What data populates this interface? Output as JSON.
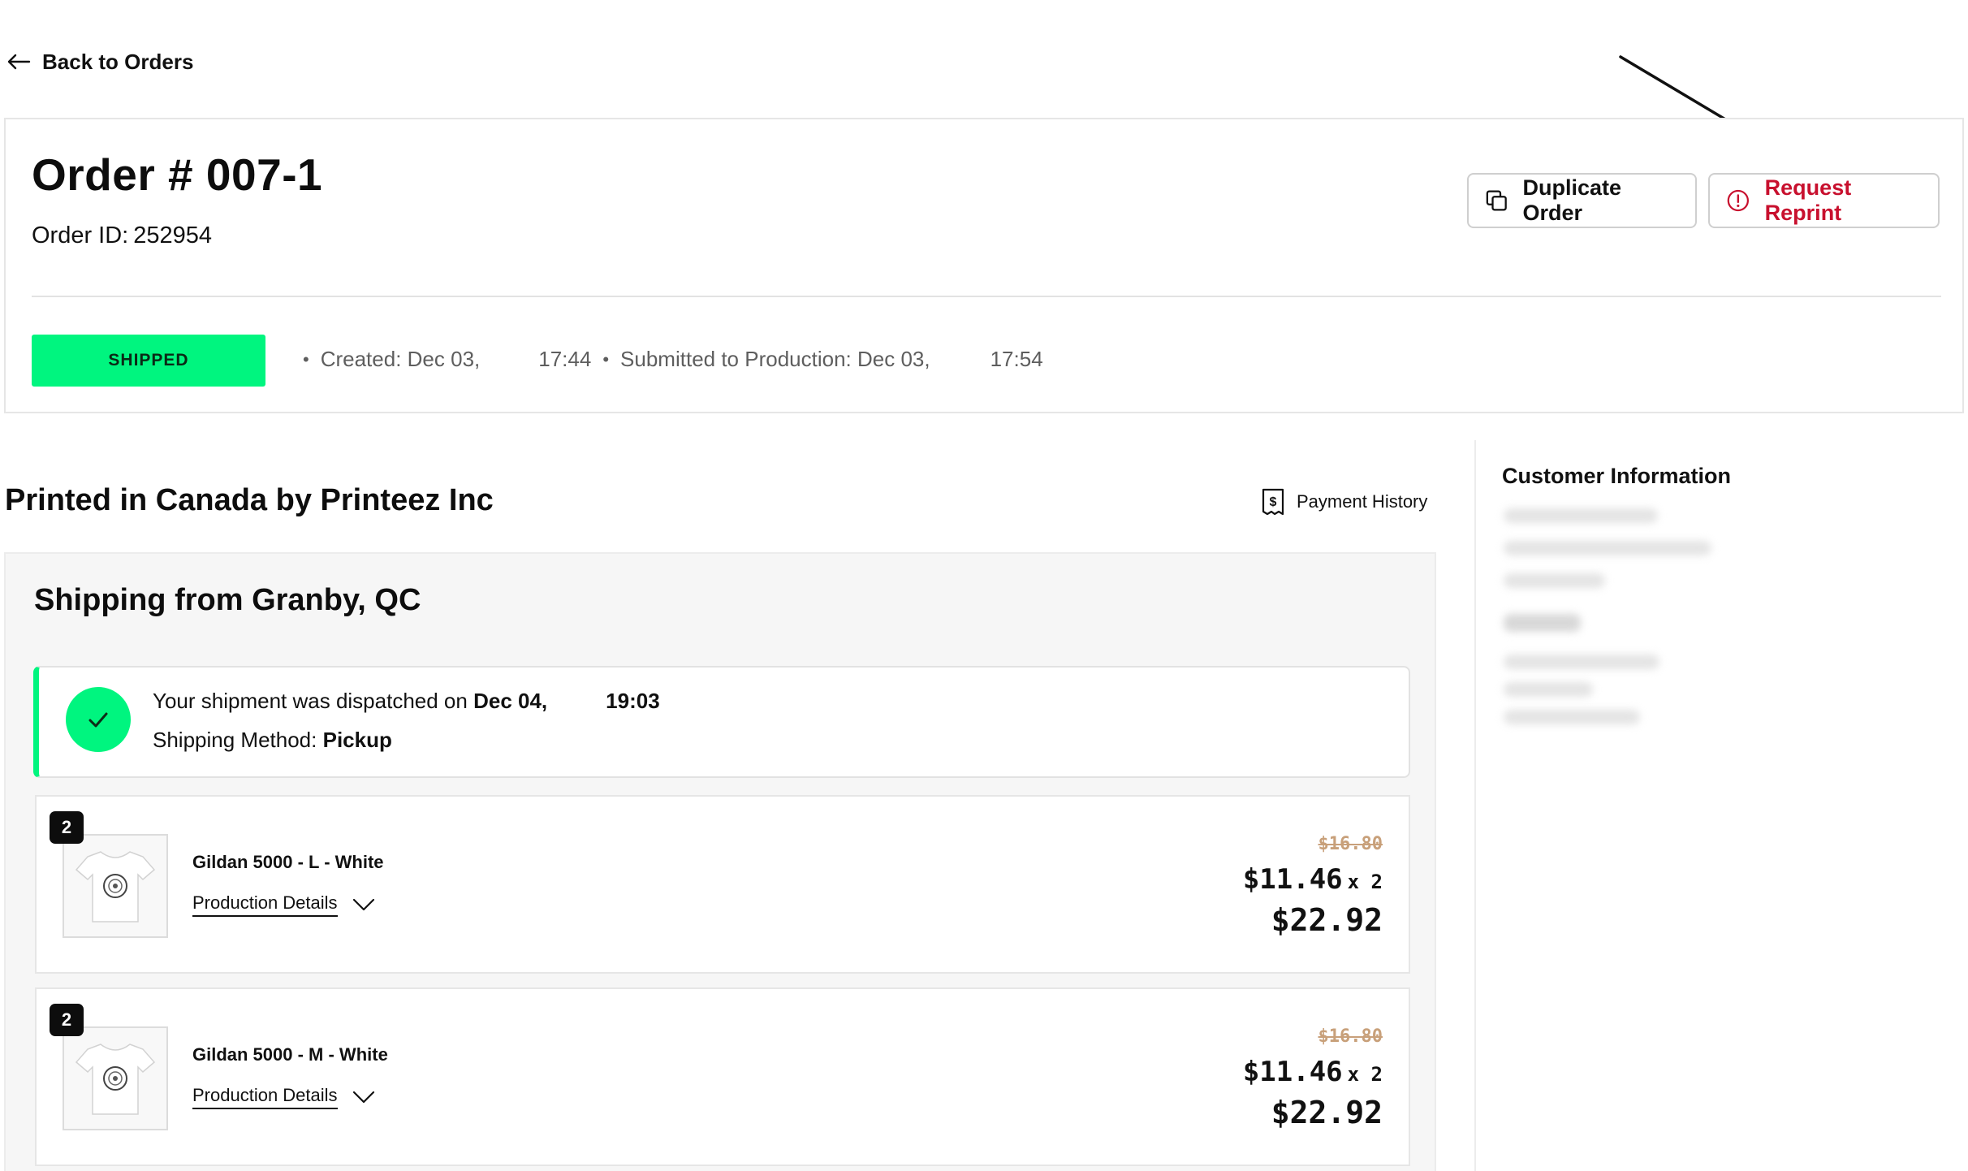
{
  "nav": {
    "back_label": "Back to Orders"
  },
  "order": {
    "title": "Order # 007-1",
    "id_label": "Order ID:",
    "id_value": "252954",
    "status": "SHIPPED",
    "created_label": "Created: Dec 03,",
    "created_time": "17:44",
    "submitted_label": "Submitted to Production: Dec 03,",
    "submitted_time": "17:54"
  },
  "actions": {
    "duplicate_label": "Duplicate Order",
    "reprint_label": "Request Reprint"
  },
  "printer": {
    "title": "Printed in Canada by Printeez Inc",
    "payment_history_label": "Payment History"
  },
  "shipping": {
    "title": "Shipping from Granby, QC",
    "dispatch_prefix": "Your shipment was dispatched on",
    "dispatch_date": "Dec 04,",
    "dispatch_time": "19:03",
    "method_label": "Shipping Method:",
    "method_value": "Pickup"
  },
  "items": [
    {
      "qty": "2",
      "name": "Gildan 5000 - L - White",
      "details_label": "Production Details",
      "old_price": "$16.80",
      "unit_price": "$11.46",
      "multiplier": "x 2",
      "total": "$22.92"
    },
    {
      "qty": "2",
      "name": "Gildan 5000 - M - White",
      "details_label": "Production Details",
      "old_price": "$16.80",
      "unit_price": "$11.46",
      "multiplier": "x 2",
      "total": "$22.92"
    }
  ],
  "customer": {
    "title": "Customer Information"
  },
  "colors": {
    "status_green": "#00f57f",
    "reprint_red": "#c8102e",
    "old_price": "#c8a07a"
  },
  "icons": {
    "back": "arrow-left-icon",
    "duplicate": "copy-icon",
    "reprint": "alert-circle-icon",
    "payment": "receipt-dollar-icon",
    "dispatch": "check-icon",
    "details": "chevron-down-icon"
  }
}
